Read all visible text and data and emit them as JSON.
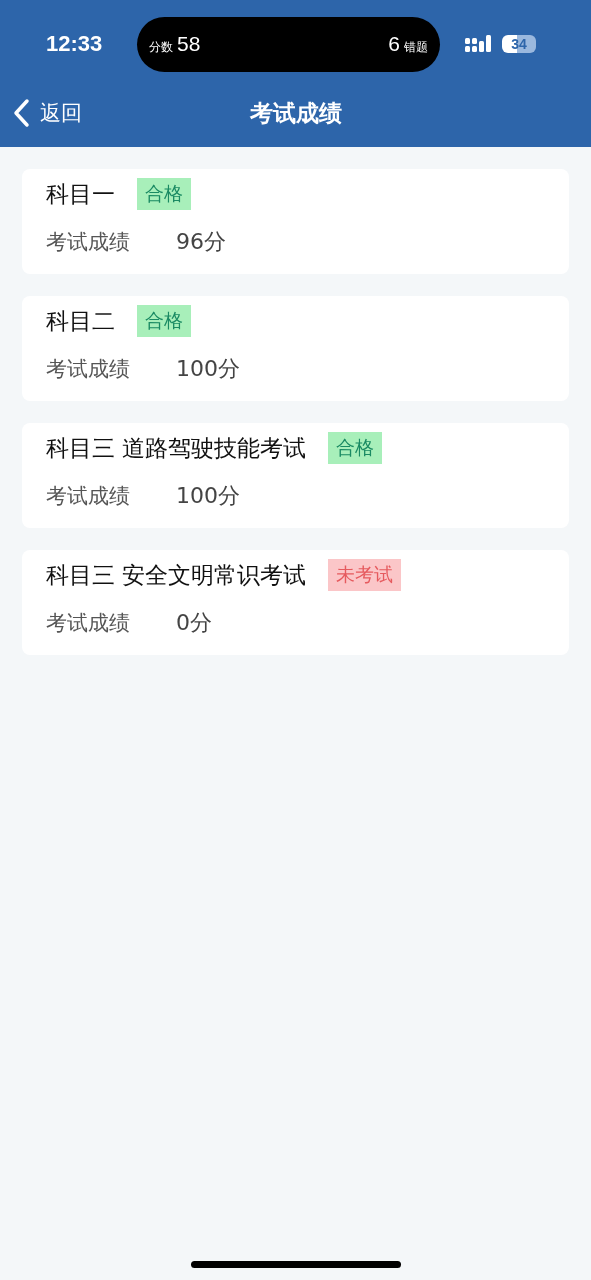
{
  "status_bar": {
    "time": "12:33",
    "island": {
      "score_label": "分数",
      "score": "58",
      "wrong_count": "6",
      "wrong_label": "错题"
    },
    "battery": "34"
  },
  "nav": {
    "back": "返回",
    "title": "考试成绩"
  },
  "subjects": [
    {
      "name": "科目一",
      "status": {
        "kind": "pass",
        "label": "合格"
      },
      "score_label": "考试成绩",
      "score": "96分"
    },
    {
      "name": "科目二",
      "status": {
        "kind": "pass",
        "label": "合格"
      },
      "score_label": "考试成绩",
      "score": "100分"
    },
    {
      "name": "科目三 道路驾驶技能考试",
      "status": {
        "kind": "pass",
        "label": "合格"
      },
      "score_label": "考试成绩",
      "score": "100分"
    },
    {
      "name": "科目三 安全文明常识考试",
      "status": {
        "kind": "untested",
        "label": "未考试"
      },
      "score_label": "考试成绩",
      "score": "0分"
    }
  ]
}
